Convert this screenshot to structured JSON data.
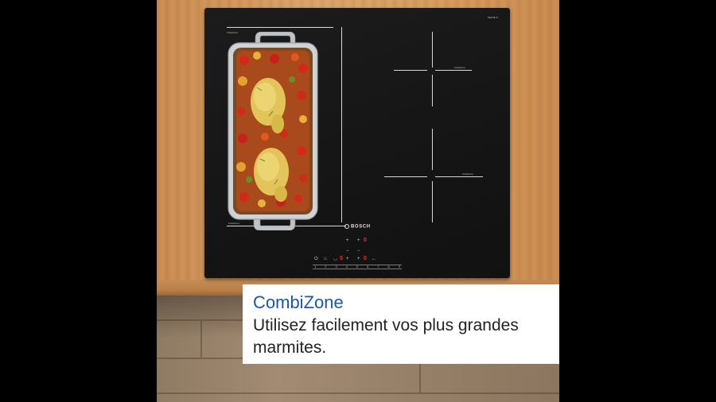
{
  "caption": {
    "title": "CombiZone",
    "body": "Utilisez facilement vos plus grandes\nmarmites."
  },
  "cooktop": {
    "brand": "BOSCH",
    "top_right_label": "SERIE 8",
    "zone_labels": [
      "Induction",
      "Induction",
      "Induction"
    ],
    "display_digits": [
      "0",
      "0",
      "5"
    ],
    "slider_scale": [
      "1",
      "2",
      "3",
      "4",
      "5",
      "6",
      "7",
      "8",
      "9"
    ],
    "colors": {
      "glass": "#151515",
      "zone_lines": "#d8d8d8",
      "display_red": "#ff2a1a"
    }
  },
  "colors": {
    "caption_title": "#1a5aa0",
    "caption_body": "#222222",
    "caption_background": "#ffffff",
    "letterbox": "#000000"
  }
}
